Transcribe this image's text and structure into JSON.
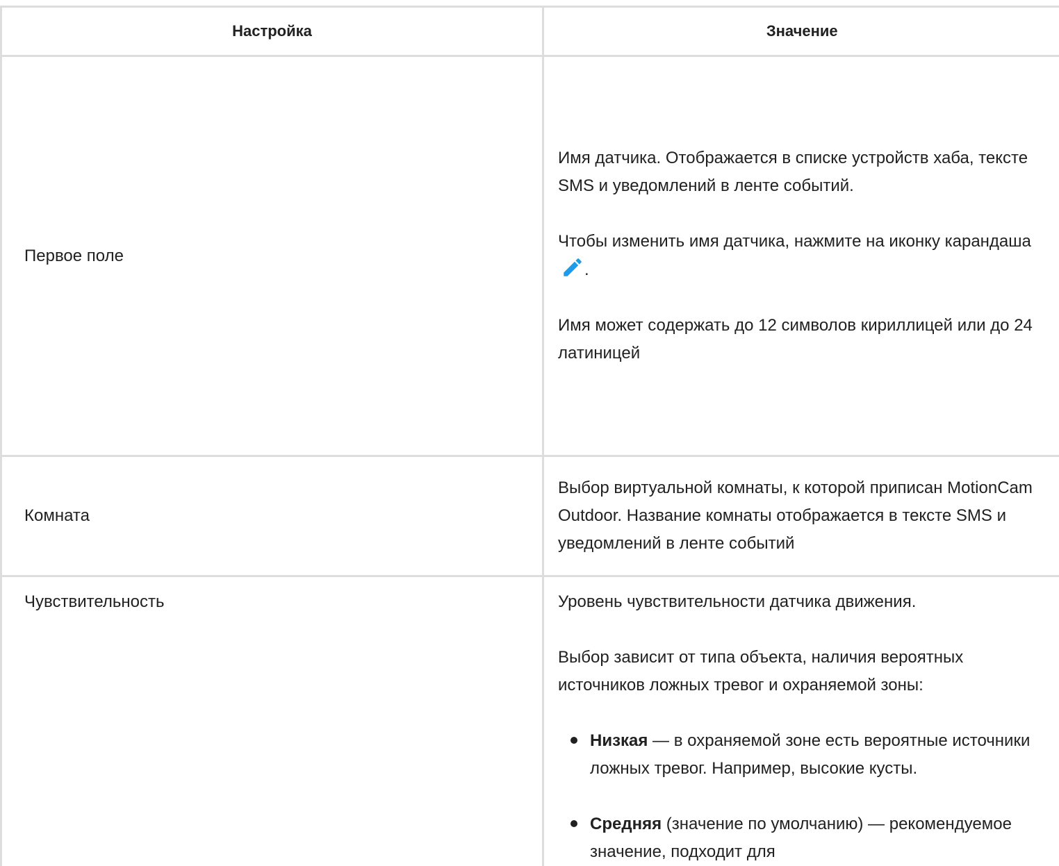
{
  "header": {
    "col_setting": "Настройка",
    "col_value": "Значение"
  },
  "rows": {
    "name": {
      "label": "Первое поле",
      "p1": "Имя датчика. Отображается в списке устройств хаба, тексте SMS и уведомлений в ленте событий.",
      "p2_before": "Чтобы изменить имя датчика, нажмите на иконку карандаша",
      "p2_after": ".",
      "pencil_icon": "pencil-icon",
      "pencil_color": "#1e9be9",
      "p3": "Имя может содержать до 12 символов кириллицей или до 24 латиницей"
    },
    "room": {
      "label": "Комната",
      "p1": "Выбор виртуальной комнаты, к которой приписан MotionCam Outdoor. Название комнаты отображается в тексте SMS и уведомлений в ленте событий"
    },
    "sensitivity": {
      "label": "Чувствительность",
      "p1": "Уровень чувствительности датчика движения.",
      "p2": "Выбор зависит от типа объекта, наличия вероятных источников ложных тревог и охраняемой зоны:",
      "items": [
        {
          "bold": "Низкая",
          "text": " — в охраняемой зоне есть вероятные источники ложных тревог. Например, высокие кусты."
        },
        {
          "bold": "Средняя",
          "text": " (значение по умолчанию) — рекомендуемое значение, подходит для"
        }
      ]
    }
  }
}
